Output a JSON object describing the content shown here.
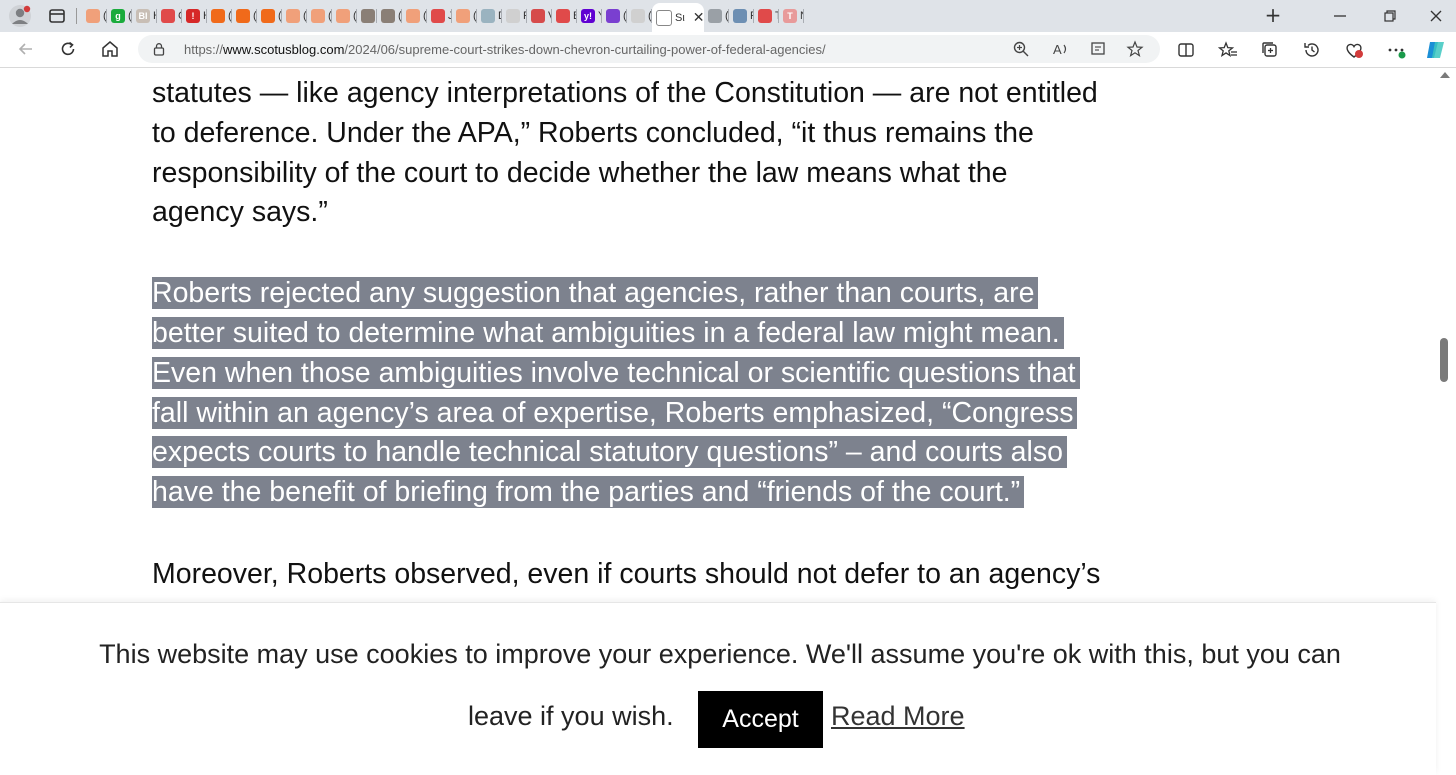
{
  "browser": {
    "tabs": [
      {
        "label": "(1",
        "color": "#f0a07a",
        "icon": "substack-icon"
      },
      {
        "label": "(4",
        "color": "#1aab3c",
        "icon": "grammarly-icon",
        "glyph": "g"
      },
      {
        "label": "H",
        "color": "#c8beb5",
        "icon": "bi-icon",
        "glyph": "BI"
      },
      {
        "label": "C",
        "color": "#e04a4a",
        "icon": "youtube-icon"
      },
      {
        "label": "H",
        "color": "#d62828",
        "icon": "alert-icon",
        "glyph": "!"
      },
      {
        "label": "(1",
        "color": "#f06a1a",
        "icon": "substack-icon"
      },
      {
        "label": "(1",
        "color": "#f06a1a",
        "icon": "substack-icon"
      },
      {
        "label": "(1",
        "color": "#f06a1a",
        "icon": "substack-icon"
      },
      {
        "label": "(1",
        "color": "#f0a07a",
        "icon": "substack-icon"
      },
      {
        "label": "(1",
        "color": "#f0a07a",
        "icon": "substack-icon"
      },
      {
        "label": "(1",
        "color": "#f0a07a",
        "icon": "substack-icon"
      },
      {
        "label": "",
        "color": "#8a7f76",
        "icon": "photo-icon"
      },
      {
        "label": "(1",
        "color": "#8a7f76",
        "icon": "photo-icon"
      },
      {
        "label": "(1",
        "color": "#f0a07a",
        "icon": "substack-icon"
      },
      {
        "label": "Ju",
        "color": "#e04a4a",
        "icon": "youtube-icon"
      },
      {
        "label": "(1",
        "color": "#f0a07a",
        "icon": "substack-icon"
      },
      {
        "label": "Di",
        "color": "#9ab3c0",
        "icon": "wave-icon"
      },
      {
        "label": "FE",
        "color": "#d0d0d0",
        "icon": "page-icon"
      },
      {
        "label": "Vi",
        "color": "#d64b4b",
        "icon": "star-icon"
      },
      {
        "label": "Ba",
        "color": "#e04a4a",
        "icon": "youtube-icon"
      },
      {
        "label": "Ya",
        "color": "#6001d2",
        "icon": "yahoo-icon",
        "glyph": "y!"
      },
      {
        "label": "(9",
        "color": "#7a3fd0",
        "icon": "mail-icon"
      },
      {
        "label": "(1",
        "color": "#d0d0d0",
        "icon": "page-icon"
      },
      {
        "label": "Sι",
        "color": "#ffffff",
        "icon": "page-icon",
        "active": true
      },
      {
        "label": "(1",
        "color": "#9aa0a6",
        "icon": "copilot-icon"
      },
      {
        "label": "Fi",
        "color": "#6d8fb3",
        "icon": "chart-icon"
      },
      {
        "label": "Tr",
        "color": "#e04a4a",
        "icon": "youtube-icon"
      },
      {
        "label": "N",
        "color": "#e89a9a",
        "icon": "t-icon",
        "glyph": "T"
      }
    ],
    "url_prefix": "https://",
    "url_domain": "www.scotusblog.com",
    "url_path": "/2024/06/supreme-court-strikes-down-chevron-curtailing-power-of-federal-agencies/"
  },
  "article": {
    "para1_lines": [
      "statutes — like agency interpretations of the Constitution — are not entitled",
      "to deference. Under the APA,” Roberts concluded, “it thus remains the",
      "responsibility of the court to decide whether the law means what the",
      "agency says.”"
    ],
    "para2_lines": [
      "Roberts rejected any suggestion that agencies, rather than courts, are",
      "better suited to determine what ambiguities in a federal law might mean.",
      "Even when those ambiguities involve technical or scientific questions that",
      "fall within an agency’s area of expertise, Roberts emphasized, “Congress",
      "expects courts to handle technical statutory questions” – and courts also",
      "have the benefit of briefing from the parties and “friends of the court.”"
    ],
    "para3_lines": [
      "Moreover, Roberts observed, even if courts should not defer to an agency’s"
    ],
    "highlight_color": "#7d828e"
  },
  "cookie_banner": {
    "message_line1": "This website may use cookies to improve your experience. We'll assume you're ok with this, but you can",
    "message_line2": "leave if you wish.",
    "accept_label": "Accept",
    "read_more_label": "Read More"
  }
}
